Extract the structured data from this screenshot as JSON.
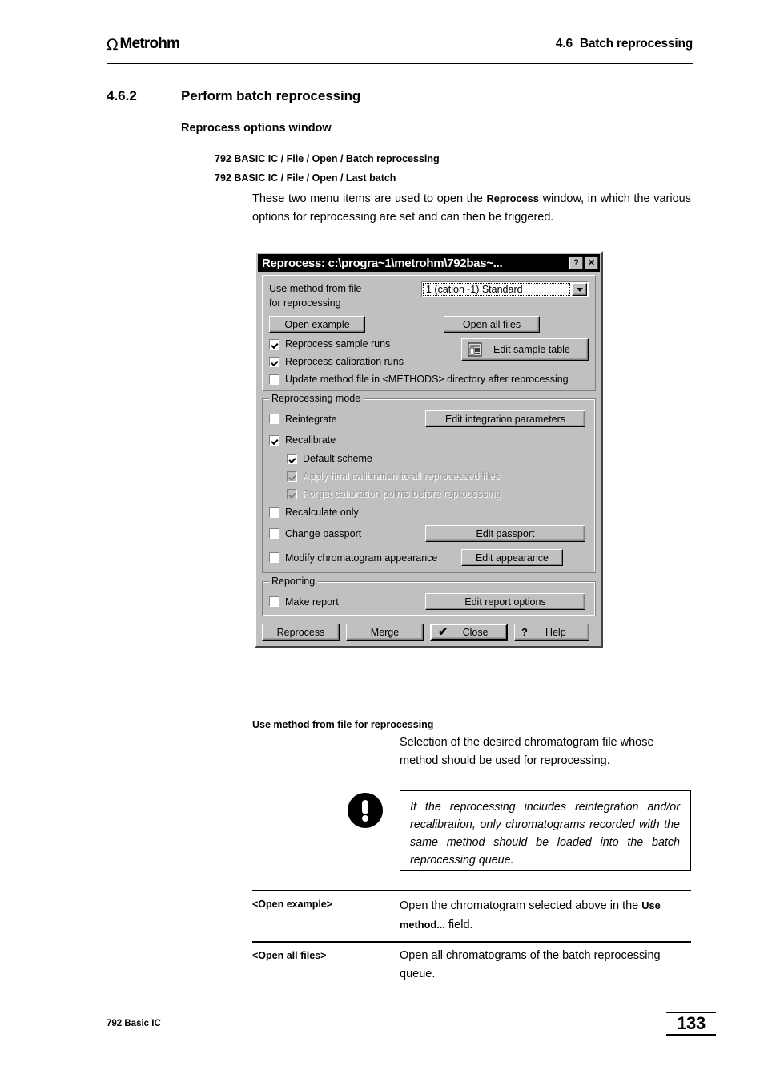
{
  "header": {
    "logo_omega": "Ω",
    "logo_text": "Metrohm",
    "chapter_number": "4.6",
    "chapter_title": "Batch reprocessing"
  },
  "section": {
    "number": "4.6.2",
    "title": "Perform batch reprocessing",
    "subtitle": "Reprocess options window",
    "menu_path_1": "792 BASIC IC / File / Open / Batch reprocessing",
    "menu_path_2": "792 BASIC IC / File / Open / Last batch",
    "intro_before": "These two menu items are used to open the ",
    "intro_bold": "Reprocess",
    "intro_after": " window, in which the various options for reprocessing are set and can then be triggered."
  },
  "dialog": {
    "title": "Reprocess: c:\\progra~1\\metrohm\\792bas~...",
    "help_button": "?",
    "close_button": "✕",
    "method_label_line1": "Use method from file",
    "method_label_line2": "for reprocessing",
    "method_value": "1  (cation~1)  Standard",
    "open_example_button": "Open example",
    "open_all_files_button": "Open all files",
    "edit_sample_table_button": "Edit sample table",
    "cb_reprocess_sample_runs": "Reprocess sample runs",
    "cb_reprocess_calibration_runs": "Reprocess calibration runs",
    "cb_update_method_file": "Update method file in <METHODS> directory after reprocessing",
    "mode_group_legend": "Reprocessing mode",
    "cb_reintegrate": "Reintegrate",
    "edit_integration_parameters_button": "Edit integration parameters",
    "cb_recalibrate": "Recalibrate",
    "cb_default_scheme": "Default scheme",
    "cb_apply_final_calibration": "Apply final calibration to all reprocessed files",
    "cb_forget_calibration_points": "Forget calibration points before reprocessing",
    "cb_recalculate_only": "Recalculate only",
    "cb_change_passport": "Change passport",
    "edit_passport_button": "Edit passport",
    "cb_modify_chromatogram": "Modify chromatogram appearance",
    "edit_appearance_button": "Edit appearance",
    "reporting_group_legend": "Reporting",
    "cb_make_report": "Make report",
    "edit_report_options_button": "Edit report options",
    "reprocess_button": "Reprocess",
    "merge_button": "Merge",
    "close_label": "Close",
    "close_check_glyph": "✔",
    "help_label": "Help",
    "help_glyph": "?"
  },
  "descriptions": {
    "use_method_heading": "Use method from file for reprocessing",
    "use_method_text": "Selection of the desired chromatogram file whose method should be used for reprocessing.",
    "note_text": "If the reprocessing includes reintegration and/or recalibration, only chromatograms recorded with the same method should be loaded into the batch reprocessing queue.",
    "entries": [
      {
        "term": "<Open example>",
        "text_before": "Open the chromatogram selected above in the ",
        "text_bold": "Use method...",
        "text_after": " field."
      },
      {
        "term": "<Open all files>",
        "text_before": "Open all chromatograms of the batch reprocessing queue.",
        "text_bold": "",
        "text_after": ""
      }
    ]
  },
  "footer": {
    "left_text": "792 Basic IC",
    "page_number": "133"
  }
}
